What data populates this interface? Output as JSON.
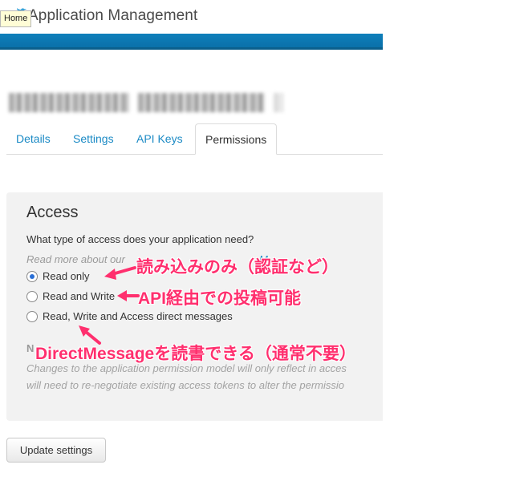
{
  "header": {
    "title": "Application Management",
    "tooltip": "Home"
  },
  "tabs": [
    {
      "label": "Details"
    },
    {
      "label": "Settings"
    },
    {
      "label": "API Keys"
    },
    {
      "label": "Permissions",
      "active": true
    }
  ],
  "access": {
    "title": "Access",
    "question": "What type of access does your application need?",
    "read_more": "Read more about our",
    "read_more_link": "M",
    "options": [
      {
        "label": "Read only",
        "selected": true
      },
      {
        "label": "Read and Write",
        "selected": false
      },
      {
        "label": "Read, Write and Access direct messages",
        "selected": false
      }
    ],
    "note_label": "N",
    "note_lines": [
      "Changes to the application permission model will only reflect in acces",
      "will need to re-negotiate existing access tokens to alter the permissio"
    ]
  },
  "actions": {
    "update_label": "Update settings"
  },
  "annotations": [
    "読み込みのみ（認証など）",
    "API経由での投稿可能",
    "DirectMessageを読書できる（通常不要）"
  ],
  "colors": {
    "accent_blue": "#0e7fbb",
    "link": "#1b8ac5",
    "annotation": "#ff2f6e"
  }
}
